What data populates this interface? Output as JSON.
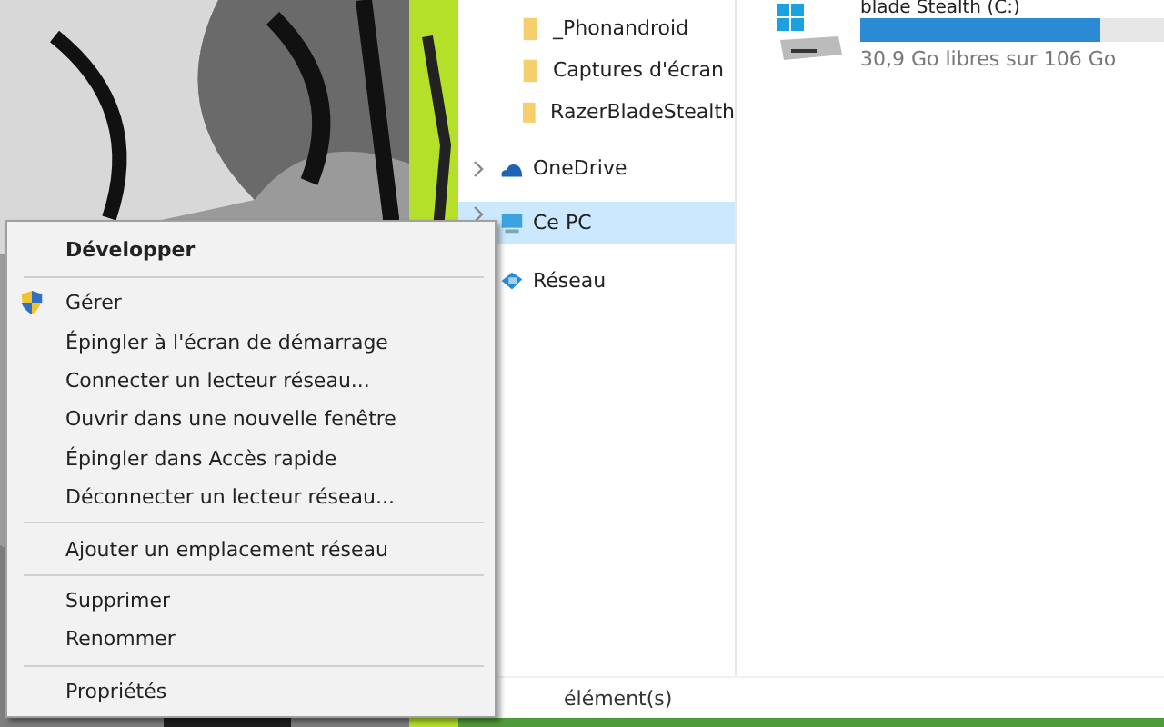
{
  "navigation": {
    "items": [
      {
        "kind": "folder",
        "label": "_Phonandroid",
        "selected": false
      },
      {
        "kind": "folder",
        "label": "Captures d'écran",
        "selected": false
      },
      {
        "kind": "folder",
        "label": "RazerBladeStealth",
        "selected": false
      },
      {
        "kind": "cloud",
        "label": "OneDrive",
        "selected": false
      },
      {
        "kind": "pc",
        "label": "Ce PC",
        "selected": true
      },
      {
        "kind": "network",
        "label": "Réseau",
        "selected": false
      }
    ]
  },
  "drive": {
    "name": "blade Stealth (C:)",
    "level": 0.78,
    "free_space": "30,9 Go libres sur 106 Go"
  },
  "status_bar": {
    "text": "élément(s)"
  },
  "context_menu": {
    "items": [
      {
        "kind": "default",
        "label": "Développer"
      },
      {
        "kind": "separator"
      },
      {
        "kind": "admin",
        "label": "Gérer"
      },
      {
        "kind": "item",
        "label": "Épingler à l'écran de démarrage"
      },
      {
        "kind": "item",
        "label": "Connecter un lecteur réseau..."
      },
      {
        "kind": "item",
        "label": "Ouvrir dans une nouvelle fenêtre"
      },
      {
        "kind": "item",
        "label": "Épingler dans Accès rapide"
      },
      {
        "kind": "item",
        "label": "Déconnecter un lecteur réseau..."
      },
      {
        "kind": "separator"
      },
      {
        "kind": "item",
        "label": "Ajouter un emplacement réseau"
      },
      {
        "kind": "separator"
      },
      {
        "kind": "item",
        "label": "Supprimer"
      },
      {
        "kind": "item",
        "label": "Renommer"
      },
      {
        "kind": "separator"
      },
      {
        "kind": "item",
        "label": "Propriétés"
      }
    ]
  }
}
